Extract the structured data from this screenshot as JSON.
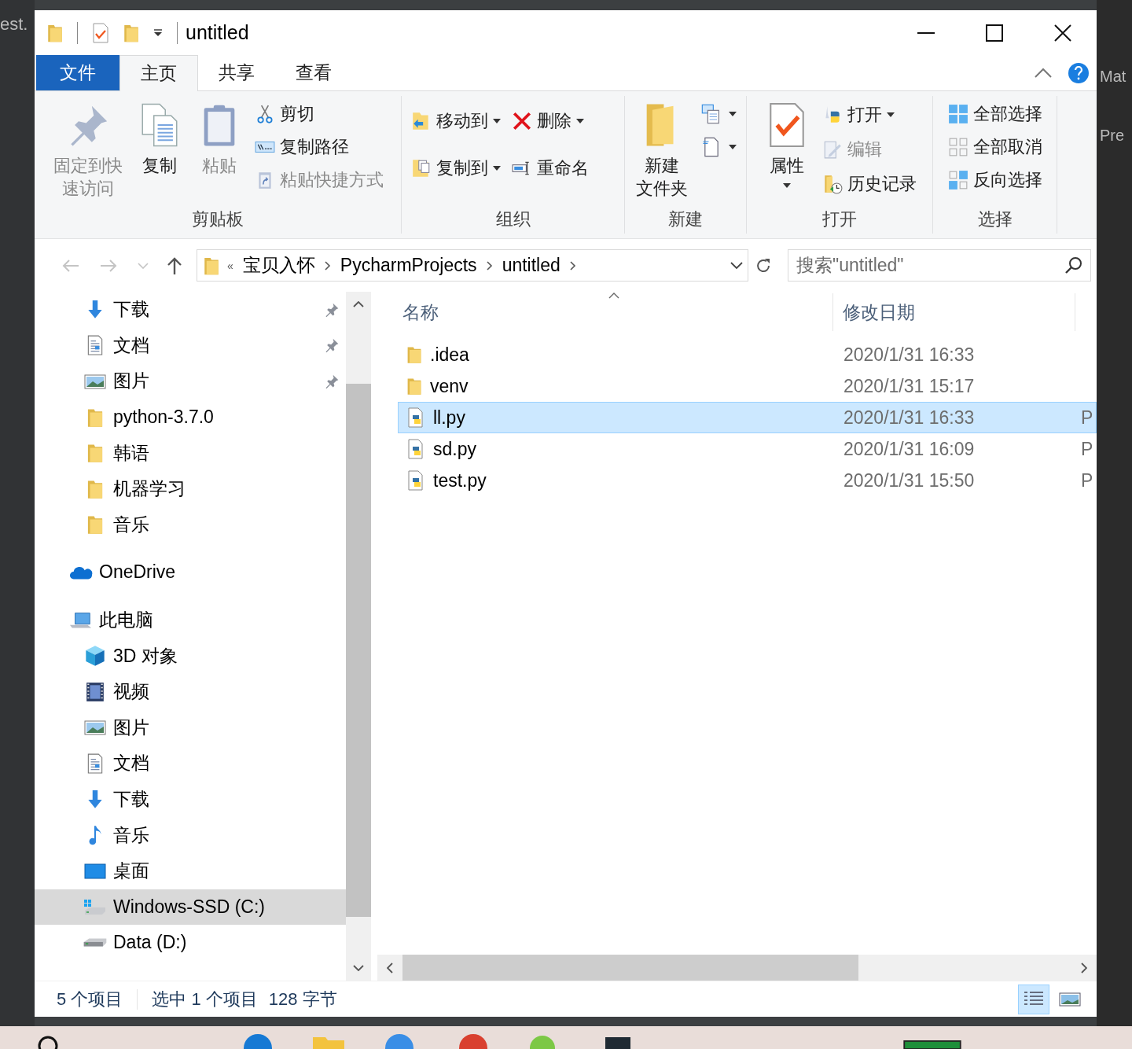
{
  "background": {
    "left_text": "est.",
    "right_texts": [
      "Mat",
      "Pre"
    ]
  },
  "window": {
    "title": "untitled"
  },
  "ribbon_tabs": [
    {
      "label": "文件",
      "kind": "menu",
      "selected": false
    },
    {
      "label": "主页",
      "kind": "tab",
      "selected": true
    },
    {
      "label": "共享",
      "kind": "tab",
      "selected": false
    },
    {
      "label": "查看",
      "kind": "tab",
      "selected": false
    }
  ],
  "ribbon_groups": [
    {
      "label": "剪贴板",
      "columns": [
        {
          "items": [
            {
              "kind": "large",
              "lines": [
                "固定到快",
                "速访问"
              ],
              "disabled": true,
              "has_menu": false
            }
          ]
        },
        {
          "items": [
            {
              "kind": "large",
              "lines": [
                "复制"
              ],
              "disabled": false,
              "has_menu": false
            }
          ]
        },
        {
          "items": [
            {
              "kind": "large",
              "lines": [
                "粘贴"
              ],
              "disabled": true,
              "has_menu": false
            }
          ]
        },
        {
          "items": [
            {
              "kind": "small",
              "label": "剪切",
              "disabled": false,
              "has_menu": false
            },
            {
              "kind": "small",
              "label": "复制路径",
              "disabled": false,
              "has_menu": false
            },
            {
              "kind": "small",
              "label": "粘贴快捷方式",
              "disabled": true,
              "has_menu": false
            }
          ]
        }
      ]
    },
    {
      "label": "组织",
      "columns": [
        {
          "items": [
            {
              "kind": "small",
              "label": "移动到",
              "disabled": false,
              "has_menu": true
            },
            {
              "kind": "small",
              "label": "复制到",
              "disabled": false,
              "has_menu": true
            }
          ]
        },
        {
          "items": [
            {
              "kind": "small",
              "label": "删除",
              "disabled": false,
              "has_menu": true
            },
            {
              "kind": "small",
              "label": "重命名",
              "disabled": false,
              "has_menu": false
            }
          ]
        }
      ]
    },
    {
      "label": "新建",
      "columns": [
        {
          "items": [
            {
              "kind": "large",
              "lines": [
                "新建",
                "文件夹"
              ],
              "disabled": false,
              "has_menu": false
            }
          ]
        },
        {
          "items": [
            {
              "kind": "icon",
              "disabled": false,
              "has_menu": true
            },
            {
              "kind": "icon",
              "disabled": false,
              "has_menu": true
            }
          ]
        }
      ]
    },
    {
      "label": "打开",
      "columns": [
        {
          "items": [
            {
              "kind": "large",
              "lines": [
                "属性"
              ],
              "disabled": false,
              "has_menu": true
            }
          ]
        },
        {
          "items": [
            {
              "kind": "small",
              "label": "打开",
              "disabled": false,
              "has_menu": true
            },
            {
              "kind": "small",
              "label": "编辑",
              "disabled": true,
              "has_menu": false
            },
            {
              "kind": "small",
              "label": "历史记录",
              "disabled": false,
              "has_menu": false
            }
          ]
        }
      ]
    },
    {
      "label": "选择",
      "columns": [
        {
          "items": [
            {
              "kind": "small",
              "label": "全部选择",
              "disabled": false,
              "has_menu": false
            },
            {
              "kind": "small",
              "label": "全部取消",
              "disabled": false,
              "has_menu": false
            },
            {
              "kind": "small",
              "label": "反向选择",
              "disabled": false,
              "has_menu": false
            }
          ]
        }
      ]
    }
  ],
  "address_bar": {
    "overflow_marker": "«",
    "crumbs": [
      "宝贝入怀",
      "PycharmProjects",
      "untitled"
    ]
  },
  "search": {
    "placeholder": "搜索\"untitled\""
  },
  "quick_access": [
    {
      "label": "下载",
      "kind": "download",
      "pinned": true,
      "selected": false
    },
    {
      "label": "文档",
      "kind": "document",
      "pinned": true,
      "selected": false
    },
    {
      "label": "图片",
      "kind": "picture",
      "pinned": true,
      "selected": false
    },
    {
      "label": "python-3.7.0",
      "kind": "folder",
      "pinned": false,
      "selected": false
    },
    {
      "label": "韩语",
      "kind": "folder",
      "pinned": false,
      "selected": false
    },
    {
      "label": "机器学习",
      "kind": "folder",
      "pinned": false,
      "selected": false
    },
    {
      "label": "音乐",
      "kind": "folder",
      "pinned": false,
      "selected": false
    }
  ],
  "nav_tree": [
    {
      "label": "OneDrive",
      "kind": "cloud",
      "selected": false
    },
    {
      "label": "此电脑",
      "kind": "computer",
      "selected": false,
      "children": [
        {
          "label": "3D 对象",
          "kind": "cube",
          "selected": false
        },
        {
          "label": "视频",
          "kind": "video",
          "selected": false
        },
        {
          "label": "图片",
          "kind": "picture",
          "selected": false
        },
        {
          "label": "文档",
          "kind": "document",
          "selected": false
        },
        {
          "label": "下载",
          "kind": "download",
          "selected": false
        },
        {
          "label": "音乐",
          "kind": "music",
          "selected": false
        },
        {
          "label": "桌面",
          "kind": "desktop",
          "selected": false
        },
        {
          "label": "Windows-SSD (C:)",
          "kind": "system-drive",
          "selected": true
        },
        {
          "label": "Data (D:)",
          "kind": "drive",
          "selected": false
        }
      ]
    }
  ],
  "file_list": {
    "columns": [
      {
        "label": "名称"
      },
      {
        "label": "修改日期"
      }
    ],
    "rows": [
      {
        "name": ".idea",
        "kind": "folder",
        "modified": "2020/1/31 16:33",
        "selected": false
      },
      {
        "name": "venv",
        "kind": "folder",
        "modified": "2020/1/31 15:17",
        "selected": false
      },
      {
        "name": "ll.py",
        "kind": "python",
        "modified": "2020/1/31 16:33",
        "column_3": "P",
        "selected": true
      },
      {
        "name": "sd.py",
        "kind": "python",
        "modified": "2020/1/31 16:09",
        "column_3": "P",
        "selected": false
      },
      {
        "name": "test.py",
        "kind": "python",
        "modified": "2020/1/31 15:50",
        "column_3": "P",
        "selected": false
      }
    ]
  },
  "status_bar": {
    "item_count": "5 个项目",
    "selection": "选中 1 个项目",
    "size": "128 字节",
    "views": [
      {
        "kind": "details",
        "selected": true
      },
      {
        "kind": "large-icons",
        "selected": false
      }
    ]
  }
}
